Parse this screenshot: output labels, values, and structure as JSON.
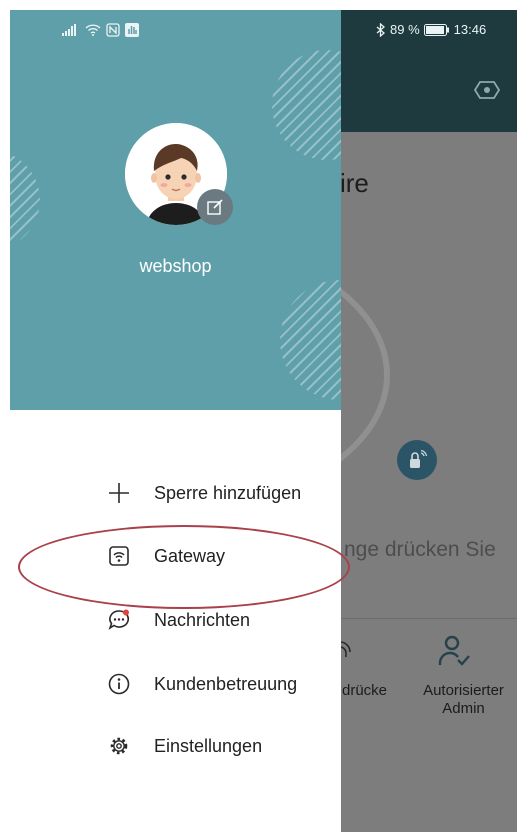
{
  "status_bar": {
    "battery": "89 %",
    "time": "13:46",
    "icons": [
      "signal-icon",
      "wifi-icon",
      "nfc-icon",
      "app-notification-icon",
      "bluetooth-icon",
      "battery-icon"
    ]
  },
  "background_app": {
    "title_fragment": "ire",
    "hint_fragment": "nge drücken Sie",
    "bottom_items": [
      {
        "label": "drücke",
        "icon": "fingerprint-icon"
      },
      {
        "label": "Autorisierter Admin",
        "icon": "admin-user-icon"
      }
    ]
  },
  "drawer": {
    "username": "webshop",
    "header_color": "#5e9faa",
    "menu": [
      {
        "label": "Sperre hinzufügen",
        "icon": "plus-icon"
      },
      {
        "label": "Gateway",
        "icon": "gateway-icon"
      },
      {
        "label": "Nachrichten",
        "icon": "message-icon",
        "badge": "#e0443e"
      },
      {
        "label": "Kundenbetreuung",
        "icon": "info-icon"
      },
      {
        "label": "Einstellungen",
        "icon": "settings-icon"
      }
    ]
  },
  "annotation": {
    "highlighted_item": "Gateway",
    "color": "#a9404a"
  }
}
